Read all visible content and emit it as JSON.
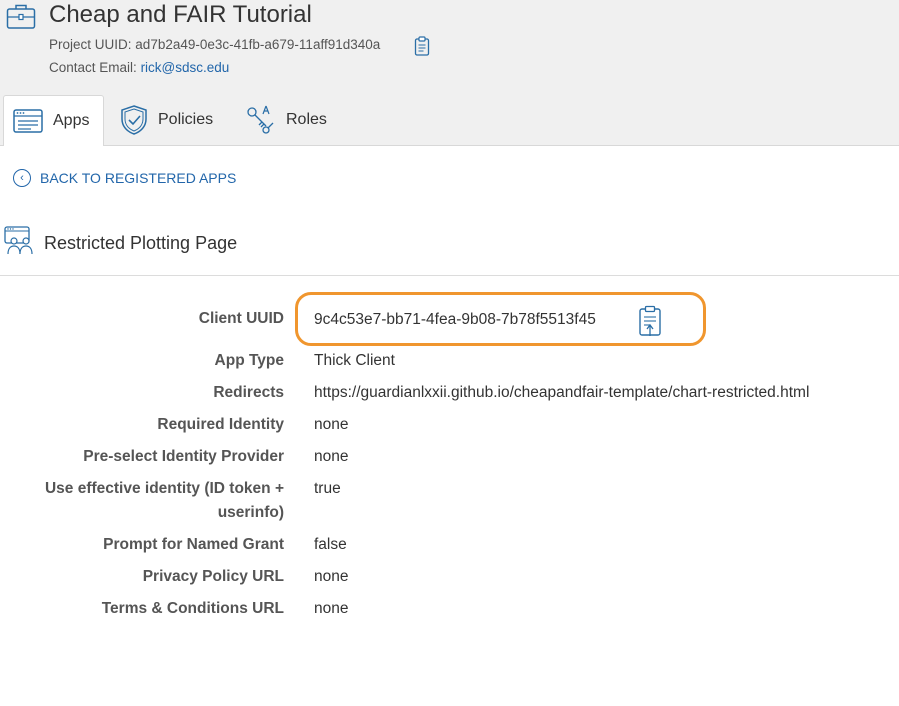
{
  "project": {
    "title": "Cheap and FAIR Tutorial",
    "uuid_label": "Project UUID:",
    "uuid": "ad7b2a49-0e3c-41fb-a679-11aff91d340a",
    "email_label": "Contact Email:",
    "email": "rick@sdsc.edu"
  },
  "tabs": [
    {
      "label": "Apps"
    },
    {
      "label": "Policies"
    },
    {
      "label": "Roles"
    }
  ],
  "back_link": "BACK TO REGISTERED APPS",
  "app": {
    "title": "Restricted Plotting Page",
    "fields": [
      {
        "label": "Client UUID",
        "value": "9c4c53e7-bb71-4fea-9b08-7b78f5513f45"
      },
      {
        "label": "App Type",
        "value": "Thick Client"
      },
      {
        "label": "Redirects",
        "value": "https://guardianlxxii.github.io/cheapandfair-template/chart-restricted.html"
      },
      {
        "label": "Required Identity",
        "value": "none"
      },
      {
        "label": "Pre-select Identity Provider",
        "value": "none"
      },
      {
        "label": "Use effective identity (ID token + userinfo)",
        "value": "true"
      },
      {
        "label": "Prompt for Named Grant",
        "value": "false"
      },
      {
        "label": "Privacy Policy URL",
        "value": "none"
      },
      {
        "label": "Terms & Conditions URL",
        "value": "none"
      }
    ]
  },
  "colors": {
    "link": "#2266aa",
    "highlight": "#f0962e",
    "icon_blue": "#2a6ea6"
  }
}
